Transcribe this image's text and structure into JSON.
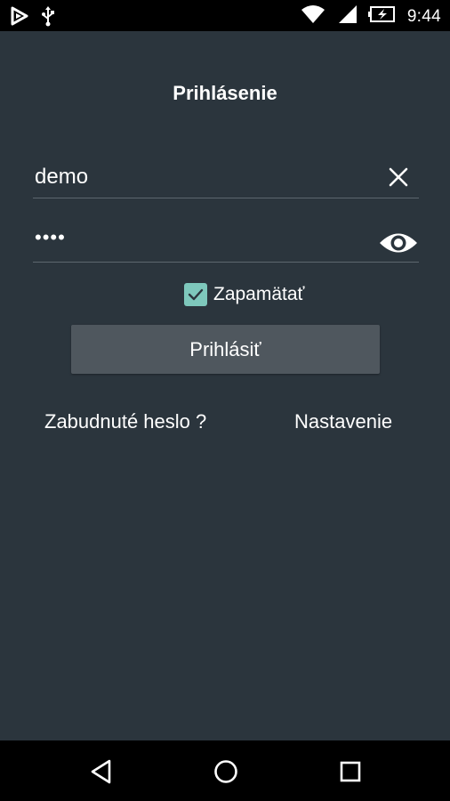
{
  "status_bar": {
    "time": "9:44",
    "left_icons": [
      "notification-app-icon",
      "usb-icon"
    ],
    "right_icons": [
      "wifi-icon",
      "signal-icon",
      "battery-charging-icon"
    ]
  },
  "login": {
    "title": "Prihlásenie",
    "username_value": "demo",
    "password_value": "••••",
    "remember_label": "Zapamätať",
    "remember_checked": true,
    "login_button_label": "Prihlásiť",
    "forgot_password_label": "Zabudnuté heslo ?",
    "settings_label": "Nastavenie"
  },
  "nav_bar": {
    "buttons": [
      "back-icon",
      "home-icon",
      "recents-icon"
    ]
  },
  "colors": {
    "background": "#2b353d",
    "accent_checkbox": "#7ec8bc",
    "button": "#4f575e"
  }
}
